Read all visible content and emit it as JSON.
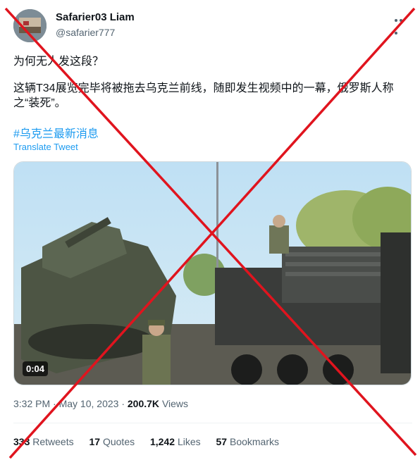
{
  "author": {
    "name": "Safarier03 Liam",
    "handle": "@safarier777"
  },
  "tweet": {
    "line1": "为何无人发这段？",
    "line2": "这辆T34展览完毕将被拖去乌克兰前线，随即发生视频中的一幕，俄罗斯人称之“装死”。",
    "hashtag": "#乌克兰最新消息",
    "translate": "Translate Tweet"
  },
  "media": {
    "duration": "0:04"
  },
  "meta": {
    "time": "3:32 PM",
    "date": "May 10, 2023",
    "views_count": "200.7K",
    "views_label": "Views",
    "sep": "·"
  },
  "stats": [
    {
      "count": "333",
      "label": "Retweets"
    },
    {
      "count": "17",
      "label": "Quotes"
    },
    {
      "count": "1,242",
      "label": "Likes"
    },
    {
      "count": "57",
      "label": "Bookmarks"
    }
  ],
  "overlay": {
    "cross_color": "#e0141e"
  }
}
